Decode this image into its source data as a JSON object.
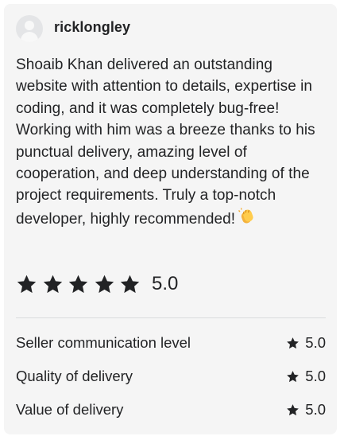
{
  "review": {
    "username": "ricklongley",
    "text": "Shoaib Khan delivered an outstanding website with attention to details, expertise in coding, and it was completely bug-free! Working with him was a breeze thanks to his punctual delivery, amazing level of cooperation, and deep understanding of the project requirements. Truly a top-notch developer, highly recommended!",
    "emoji": "clapping-hands",
    "overall_rating": "5.0",
    "stars_filled": 5,
    "stars_total": 5
  },
  "breakdown": [
    {
      "label": "Seller communication level",
      "value": "5.0"
    },
    {
      "label": "Quality of delivery",
      "value": "5.0"
    },
    {
      "label": "Value of delivery",
      "value": "5.0"
    }
  ],
  "colors": {
    "card_background": "#f5f5f5",
    "text": "#222325",
    "star": "#222325",
    "divider": "#dadbdd",
    "avatar": "#e4e5e7"
  }
}
